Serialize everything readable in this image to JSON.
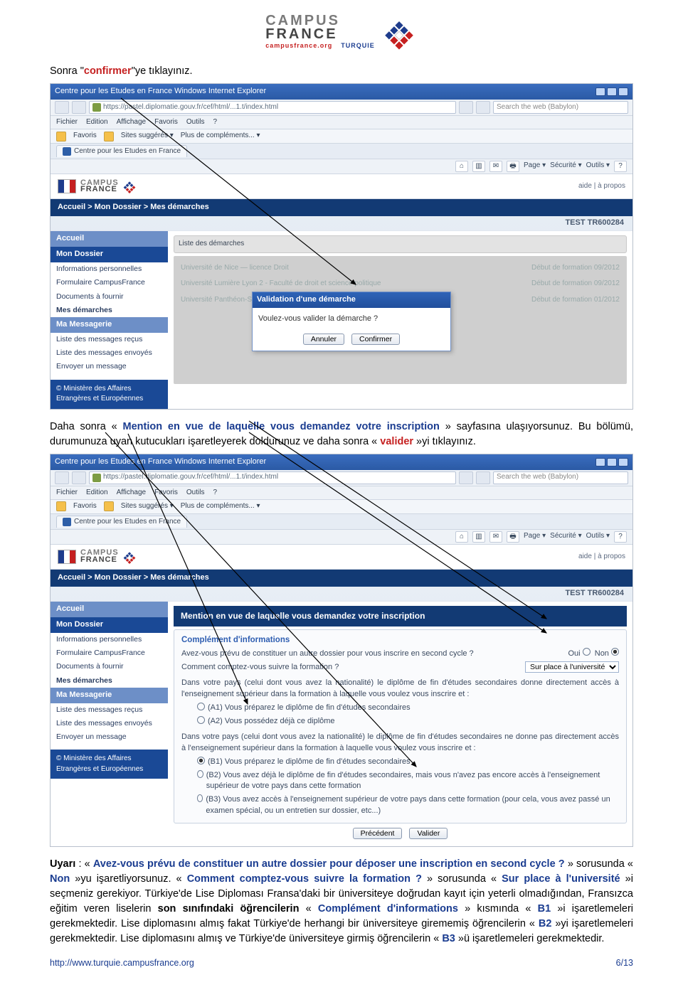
{
  "logo": {
    "campus": "CAMPUS",
    "france": "FRANCE",
    "url": "campusfrance.org",
    "country": "TURQUIE"
  },
  "text": {
    "line1_a": "Sonra \"",
    "line1_b": "confirmer",
    "line1_c": "\"ye tıklayınız.",
    "p2_a": "Daha sonra « ",
    "p2_b": "Mention en vue de laquelle vous demandez votre inscription",
    "p2_c": " » sayfasına ulaşıyorsunuz. Bu bölümü, durumunuza uyan kutucukları işaretleyerek doldurunuz ve daha sonra « ",
    "p2_d": "valider",
    "p2_e": " »yi tıklayınız.",
    "p3_l": "Uyarı",
    "p3_a": " : « ",
    "p3_b": "Avez-vous prévu de constituer un autre dossier pour déposer une inscription en second cycle ?",
    "p3_c": " » sorusunda « ",
    "p3_d": "Non",
    "p3_e": " »yu işaretliyorsunuz. « ",
    "p3_f": "Comment comptez-vous suivre la formation ?",
    "p3_g": " » sorusunda « ",
    "p3_h": "Sur place à l'université",
    "p3_i": " »i seçmeniz gerekiyor.  Türkiye'de Lise Diploması Fransa'daki bir üniversiteye doğrudan kayıt için yeterli olmadığından, Fransızca eğitim veren liselerin ",
    "p3_j": "son sınıfındaki öğrencilerin",
    "p3_k": " « ",
    "p3_l2": "Complément d'informations",
    "p3_m": " » kısmında « ",
    "p3_n": "B1",
    "p3_o": " »i işaretlemeleri gerekmektedir. Lise diplomasını almış fakat Türkiye'de herhangi bir üniversiteye girememiş öğrencilerin « ",
    "p3_p": "B2",
    "p3_q": " »yi işaretlemeleri gerekmektedir. Lise diplomasını almış ve Türkiye'de üniversiteye girmiş öğrencilerin « ",
    "p3_r": "B3",
    "p3_s": " »ü işaretlemeleri gerekmektedir."
  },
  "browser": {
    "title": "Centre pour les Etudes en France Windows Internet Explorer",
    "url": "https://pastel.diplomatie.gouv.fr/cef/html/...1.t/index.html",
    "search": "Search the web (Babylon)",
    "menus": [
      "Fichier",
      "Edition",
      "Affichage",
      "Favoris",
      "Outils",
      "?"
    ],
    "fav_label": "Favoris",
    "fav_sug": "Sites suggérés ▾",
    "fav_plus": "Plus de compléments... ▾",
    "tab": "Centre pour les Etudes en France",
    "pagetools": [
      "Page ▾",
      "Sécurité ▾",
      "Outils ▾"
    ]
  },
  "site": {
    "headright": "aide  |  à propos",
    "breadcrumb": "Accueil > Mon Dossier > Mes démarches",
    "userid": "TEST   TR600284",
    "nav": {
      "accueil": "Accueil",
      "mondossier": "Mon Dossier",
      "items1": [
        "Informations personnelles",
        "Formulaire CampusFrance",
        "Documents à fournir",
        "Mes démarches"
      ],
      "mamsg": "Ma Messagerie",
      "items2": [
        "Liste des messages reçus",
        "Liste des messages envoyés",
        "Envoyer un message"
      ],
      "footer": "© Ministère des Affaires Etrangères et Européennes"
    }
  },
  "s1": {
    "listtitle": "Liste des démarches",
    "modal_title": "Validation d'une démarche",
    "modal_text": "Voulez-vous valider la démarche ?",
    "btn_cancel": "Annuler",
    "btn_confirm": "Confirmer"
  },
  "s2": {
    "header": "Mention en vue de laquelle vous demandez votre inscription",
    "sub1": "Complément d'informations",
    "q1": "Avez-vous prévu de constituer un autre dossier pour vous inscrire en second cycle ?",
    "q2": "Comment comptez-vous suivre la formation ?",
    "oui": "Oui",
    "non": "Non",
    "select": "Sur place à l'université",
    "para1": "Dans votre pays (celui dont vous avez la nationalité) le diplôme de fin d'études secondaires donne directement accès à l'enseignement supérieur dans la formation à laquelle vous voulez vous inscrire et :",
    "optA1": "(A1) Vous préparez le diplôme de fin d'études secondaires",
    "optA2": "(A2) Vous possédez déjà ce diplôme",
    "para2": "Dans votre pays (celui dont vous avez la nationalité) le diplôme de fin d'études secondaires ne donne pas directement accès à l'enseignement supérieur dans la formation à laquelle vous voulez vous inscrire et :",
    "optB1": "(B1) Vous préparez le diplôme de fin d'études secondaires",
    "optB2": "(B2) Vous avez déjà le diplôme de fin d'études secondaires, mais vous n'avez pas encore accès à l'enseignement supérieur de votre pays dans cette formation",
    "optB3": "(B3) Vous avez accès à l'enseignement supérieur de votre pays dans cette formation (pour cela, vous avez passé un examen spécial, ou un entretien sur dossier, etc...)",
    "btn_prev": "Précédent",
    "btn_valid": "Valider"
  },
  "footer": {
    "url": "http://www.turquie.campusfrance.org",
    "page": "6/13"
  }
}
